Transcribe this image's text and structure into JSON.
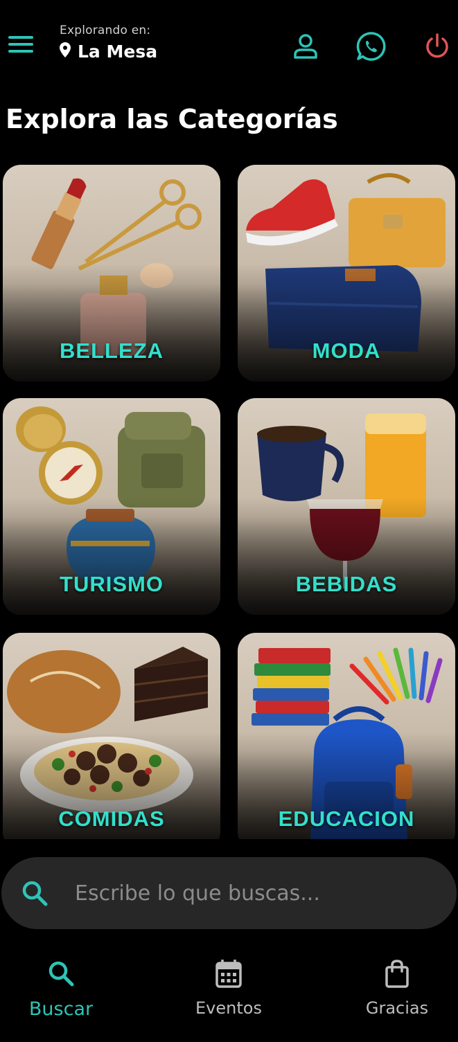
{
  "header": {
    "exploring_label": "Explorando en:",
    "location": "La Mesa",
    "icons": [
      "menu-icon",
      "location-pin-icon",
      "user-icon",
      "whatsapp-icon",
      "power-icon"
    ]
  },
  "page": {
    "title": "Explora las Categorías"
  },
  "categories": [
    {
      "label": "BELLEZA"
    },
    {
      "label": "MODA"
    },
    {
      "label": "TURISMO"
    },
    {
      "label": "BEBIDAS"
    },
    {
      "label": "COMIDAS"
    },
    {
      "label": "EDUCACION"
    }
  ],
  "search": {
    "placeholder": "Escribe lo que buscas..."
  },
  "nav": {
    "items": [
      {
        "label": "Buscar",
        "icon": "search-icon",
        "active": true
      },
      {
        "label": "Eventos",
        "icon": "calendar-icon",
        "active": false
      },
      {
        "label": "Gracias",
        "icon": "shopping-bag-icon",
        "active": false
      }
    ]
  },
  "colors": {
    "accent": "#2ec4b6",
    "label": "#32e0cc",
    "power": "#e05555",
    "background": "#000000",
    "search_bg": "#272727"
  }
}
